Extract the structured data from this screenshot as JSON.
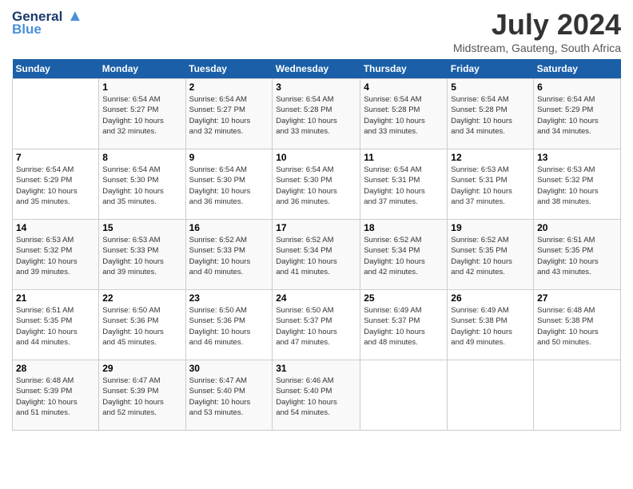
{
  "logo": {
    "line1": "General",
    "line2": "Blue",
    "tagline": "▲"
  },
  "header": {
    "month": "July 2024",
    "location": "Midstream, Gauteng, South Africa"
  },
  "days_of_week": [
    "Sunday",
    "Monday",
    "Tuesday",
    "Wednesday",
    "Thursday",
    "Friday",
    "Saturday"
  ],
  "weeks": [
    [
      {
        "day": "",
        "info": ""
      },
      {
        "day": "1",
        "info": "Sunrise: 6:54 AM\nSunset: 5:27 PM\nDaylight: 10 hours\nand 32 minutes."
      },
      {
        "day": "2",
        "info": "Sunrise: 6:54 AM\nSunset: 5:27 PM\nDaylight: 10 hours\nand 32 minutes."
      },
      {
        "day": "3",
        "info": "Sunrise: 6:54 AM\nSunset: 5:28 PM\nDaylight: 10 hours\nand 33 minutes."
      },
      {
        "day": "4",
        "info": "Sunrise: 6:54 AM\nSunset: 5:28 PM\nDaylight: 10 hours\nand 33 minutes."
      },
      {
        "day": "5",
        "info": "Sunrise: 6:54 AM\nSunset: 5:28 PM\nDaylight: 10 hours\nand 34 minutes."
      },
      {
        "day": "6",
        "info": "Sunrise: 6:54 AM\nSunset: 5:29 PM\nDaylight: 10 hours\nand 34 minutes."
      }
    ],
    [
      {
        "day": "7",
        "info": "Sunrise: 6:54 AM\nSunset: 5:29 PM\nDaylight: 10 hours\nand 35 minutes."
      },
      {
        "day": "8",
        "info": "Sunrise: 6:54 AM\nSunset: 5:30 PM\nDaylight: 10 hours\nand 35 minutes."
      },
      {
        "day": "9",
        "info": "Sunrise: 6:54 AM\nSunset: 5:30 PM\nDaylight: 10 hours\nand 36 minutes."
      },
      {
        "day": "10",
        "info": "Sunrise: 6:54 AM\nSunset: 5:30 PM\nDaylight: 10 hours\nand 36 minutes."
      },
      {
        "day": "11",
        "info": "Sunrise: 6:54 AM\nSunset: 5:31 PM\nDaylight: 10 hours\nand 37 minutes."
      },
      {
        "day": "12",
        "info": "Sunrise: 6:53 AM\nSunset: 5:31 PM\nDaylight: 10 hours\nand 37 minutes."
      },
      {
        "day": "13",
        "info": "Sunrise: 6:53 AM\nSunset: 5:32 PM\nDaylight: 10 hours\nand 38 minutes."
      }
    ],
    [
      {
        "day": "14",
        "info": "Sunrise: 6:53 AM\nSunset: 5:32 PM\nDaylight: 10 hours\nand 39 minutes."
      },
      {
        "day": "15",
        "info": "Sunrise: 6:53 AM\nSunset: 5:33 PM\nDaylight: 10 hours\nand 39 minutes."
      },
      {
        "day": "16",
        "info": "Sunrise: 6:52 AM\nSunset: 5:33 PM\nDaylight: 10 hours\nand 40 minutes."
      },
      {
        "day": "17",
        "info": "Sunrise: 6:52 AM\nSunset: 5:34 PM\nDaylight: 10 hours\nand 41 minutes."
      },
      {
        "day": "18",
        "info": "Sunrise: 6:52 AM\nSunset: 5:34 PM\nDaylight: 10 hours\nand 42 minutes."
      },
      {
        "day": "19",
        "info": "Sunrise: 6:52 AM\nSunset: 5:35 PM\nDaylight: 10 hours\nand 42 minutes."
      },
      {
        "day": "20",
        "info": "Sunrise: 6:51 AM\nSunset: 5:35 PM\nDaylight: 10 hours\nand 43 minutes."
      }
    ],
    [
      {
        "day": "21",
        "info": "Sunrise: 6:51 AM\nSunset: 5:35 PM\nDaylight: 10 hours\nand 44 minutes."
      },
      {
        "day": "22",
        "info": "Sunrise: 6:50 AM\nSunset: 5:36 PM\nDaylight: 10 hours\nand 45 minutes."
      },
      {
        "day": "23",
        "info": "Sunrise: 6:50 AM\nSunset: 5:36 PM\nDaylight: 10 hours\nand 46 minutes."
      },
      {
        "day": "24",
        "info": "Sunrise: 6:50 AM\nSunset: 5:37 PM\nDaylight: 10 hours\nand 47 minutes."
      },
      {
        "day": "25",
        "info": "Sunrise: 6:49 AM\nSunset: 5:37 PM\nDaylight: 10 hours\nand 48 minutes."
      },
      {
        "day": "26",
        "info": "Sunrise: 6:49 AM\nSunset: 5:38 PM\nDaylight: 10 hours\nand 49 minutes."
      },
      {
        "day": "27",
        "info": "Sunrise: 6:48 AM\nSunset: 5:38 PM\nDaylight: 10 hours\nand 50 minutes."
      }
    ],
    [
      {
        "day": "28",
        "info": "Sunrise: 6:48 AM\nSunset: 5:39 PM\nDaylight: 10 hours\nand 51 minutes."
      },
      {
        "day": "29",
        "info": "Sunrise: 6:47 AM\nSunset: 5:39 PM\nDaylight: 10 hours\nand 52 minutes."
      },
      {
        "day": "30",
        "info": "Sunrise: 6:47 AM\nSunset: 5:40 PM\nDaylight: 10 hours\nand 53 minutes."
      },
      {
        "day": "31",
        "info": "Sunrise: 6:46 AM\nSunset: 5:40 PM\nDaylight: 10 hours\nand 54 minutes."
      },
      {
        "day": "",
        "info": ""
      },
      {
        "day": "",
        "info": ""
      },
      {
        "day": "",
        "info": ""
      }
    ]
  ]
}
